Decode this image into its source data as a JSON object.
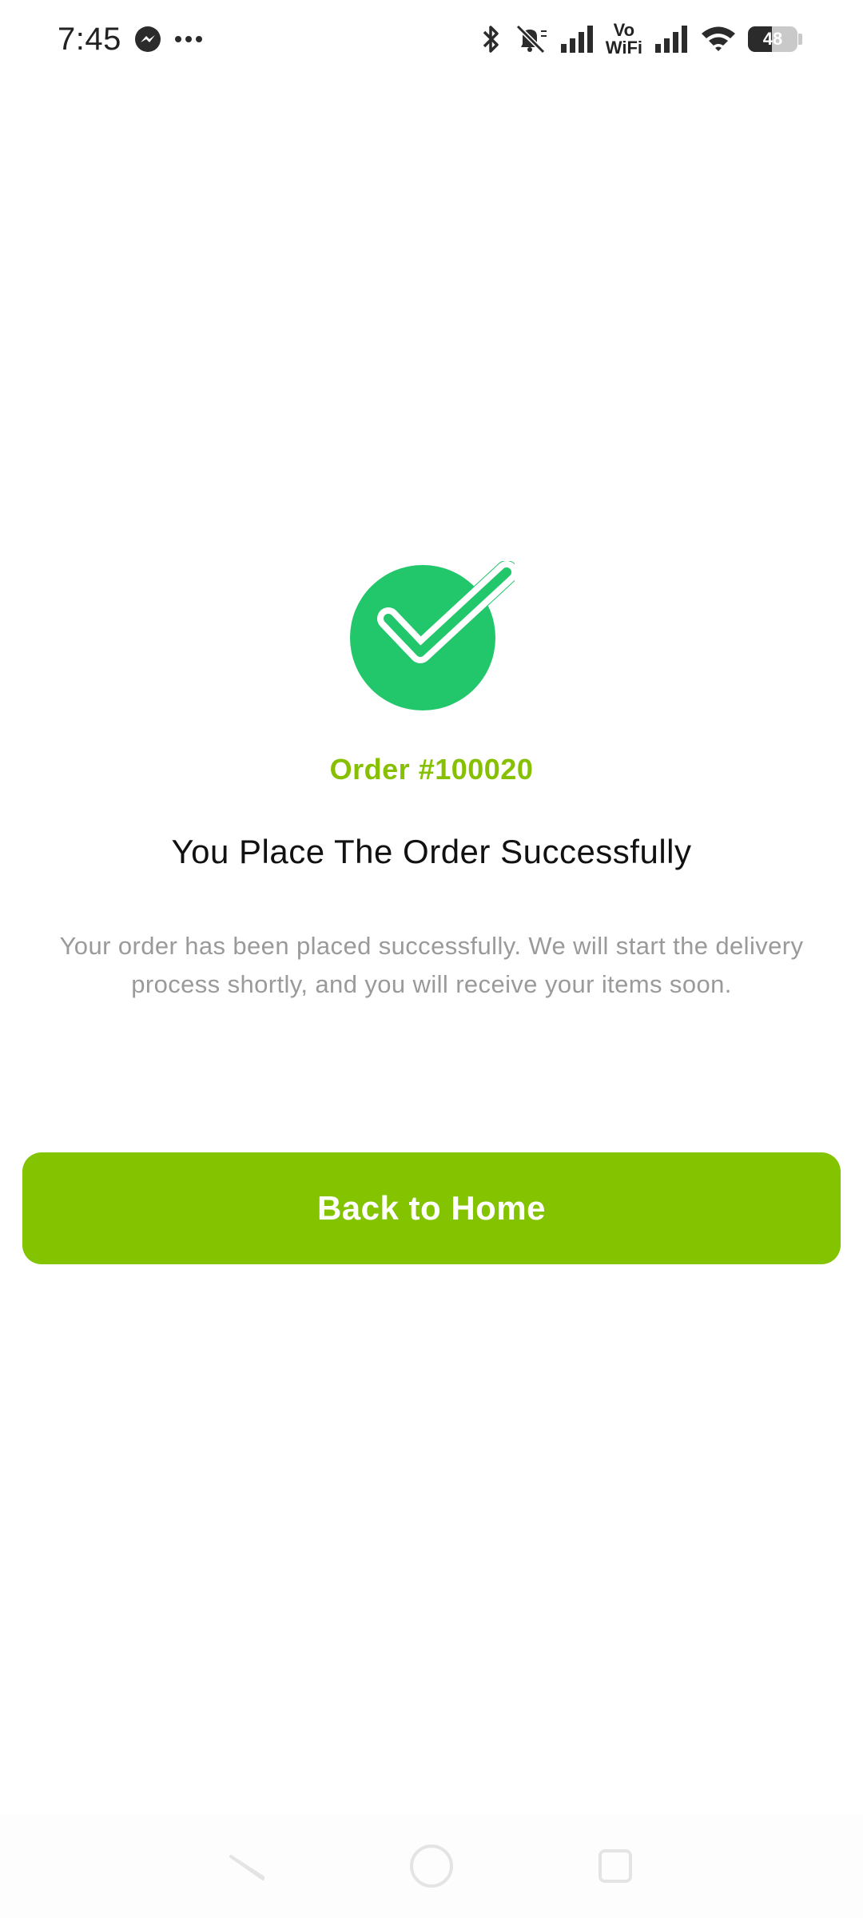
{
  "status_bar": {
    "time": "7:45",
    "messenger_icon": "messenger-icon",
    "more_icon": "more-dots-icon",
    "vowifi_top": "Vo",
    "vowifi_bottom": "WiFi",
    "battery_level": "48",
    "icons": [
      "bluetooth-icon",
      "mute-icon",
      "signal-icon",
      "vowifi-icon",
      "signal-icon",
      "wifi-icon",
      "battery-icon"
    ]
  },
  "success": {
    "icon": "check-circle-icon",
    "order_number": "Order #100020",
    "title": "You Place The Order Successfully",
    "message": "Your order has been placed successfully. We will start the delivery process shortly, and you will receive your items soon."
  },
  "actions": {
    "back_home_label": "Back to Home"
  },
  "colors": {
    "accent": "#84c300",
    "order_text": "#86c000",
    "check_circle": "#22c66b",
    "message_text": "#9a9a9a"
  },
  "nav_bar": {
    "icons": [
      "back-icon",
      "home-icon",
      "recents-icon"
    ]
  }
}
